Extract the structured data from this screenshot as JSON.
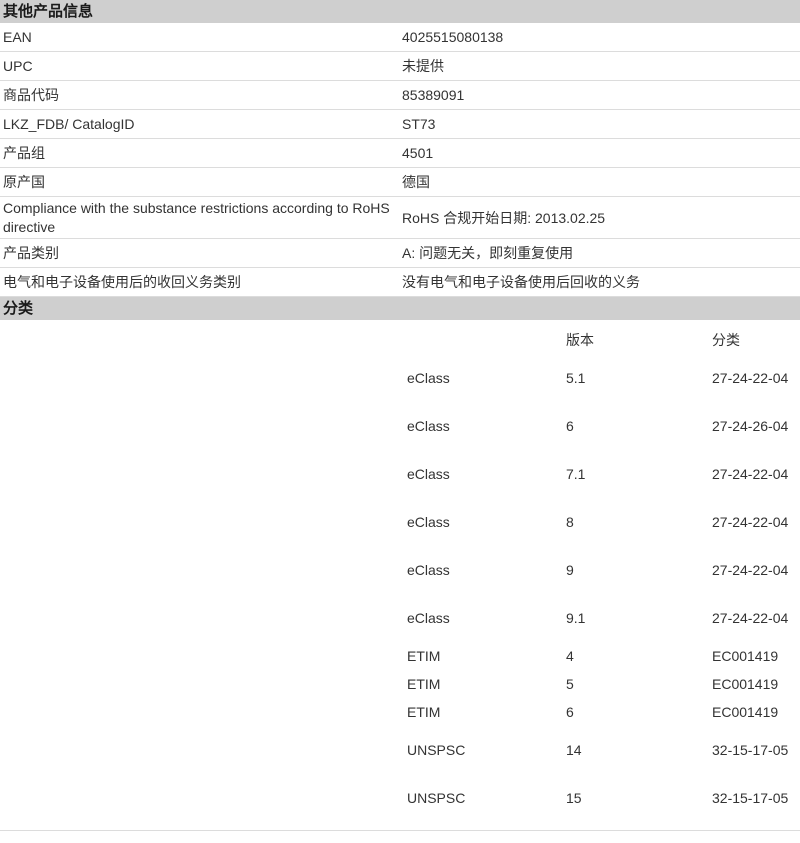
{
  "other_info": {
    "title": "其他产品信息",
    "rows": [
      {
        "key": "EAN",
        "value": "4025515080138"
      },
      {
        "key": "UPC",
        "value": "未提供"
      },
      {
        "key": "商品代码",
        "value": "85389091"
      },
      {
        "key": "LKZ_FDB/ CatalogID",
        "value": "ST73"
      },
      {
        "key": "产品组",
        "value": "4501"
      },
      {
        "key": "原产国",
        "value": "德国"
      },
      {
        "key": "Compliance with the substance restrictions according to RoHS directive",
        "value": "RoHS 合规开始日期: 2013.02.25"
      },
      {
        "key": "产品类别",
        "value": "A: 问题无关，即刻重复使用"
      },
      {
        "key": "电气和电子设备使用后的收回义务类别",
        "value": "没有电气和电子设备使用后回收的义务"
      }
    ]
  },
  "classification": {
    "title": "分类",
    "headers": {
      "version": "版本",
      "class": "分类"
    },
    "rows": [
      {
        "system": "eClass",
        "version": "5.1",
        "class": "27-24-22-04"
      },
      {
        "system": "eClass",
        "version": "6",
        "class": "27-24-26-04"
      },
      {
        "system": "eClass",
        "version": "7.1",
        "class": "27-24-22-04"
      },
      {
        "system": "eClass",
        "version": "8",
        "class": "27-24-22-04"
      },
      {
        "system": "eClass",
        "version": "9",
        "class": "27-24-22-04"
      },
      {
        "system": "eClass",
        "version": "9.1",
        "class": "27-24-22-04"
      },
      {
        "system": "ETIM",
        "version": "4",
        "class": "EC001419"
      },
      {
        "system": "ETIM",
        "version": "5",
        "class": "EC001419"
      },
      {
        "system": "ETIM",
        "version": "6",
        "class": "EC001419"
      },
      {
        "system": "UNSPSC",
        "version": "14",
        "class": "32-15-17-05"
      },
      {
        "system": "UNSPSC",
        "version": "15",
        "class": "32-15-17-05"
      }
    ]
  },
  "colors": {
    "header_bg": "#cfcfcf",
    "divider": "#dcdcdc",
    "text": "#333333"
  }
}
